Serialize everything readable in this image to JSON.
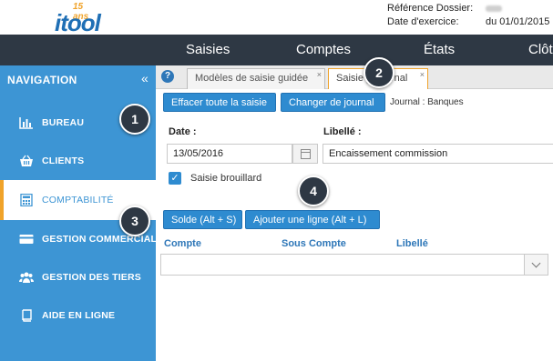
{
  "header": {
    "logo_anniv": "15 ans",
    "logo_text": "itool",
    "ref_label": "Référence Dossier:",
    "exercise_label": "Date d'exercice:",
    "exercise_value": "du 01/01/2015"
  },
  "topnav": {
    "items": [
      "Saisies",
      "Comptes",
      "États",
      "Clôt"
    ]
  },
  "sidebar": {
    "title": "NAVIGATION",
    "collapse_icon": "«",
    "items": [
      {
        "label": "BUREAU",
        "icon": "bar-chart-icon"
      },
      {
        "label": "CLIENTS",
        "icon": "basket-icon"
      },
      {
        "label": "COMPTABILITÉ",
        "icon": "calculator-icon",
        "active": true
      },
      {
        "label": "GESTION COMMERCIALE",
        "icon": "card-icon"
      },
      {
        "label": "GESTION DES TIERS",
        "icon": "users-icon"
      },
      {
        "label": "AIDE EN LIGNE",
        "icon": "book-icon"
      }
    ]
  },
  "tabs": [
    {
      "label": "Modèles de saisie guidée",
      "close": "×"
    },
    {
      "label": "Saisie p",
      "label_tail": "rnal",
      "close": "×",
      "active": true
    }
  ],
  "toolbar": {
    "clear_label": "Effacer toute la saisie",
    "change_journal_label": "Changer de journal",
    "journal_prefix": "Journal : ",
    "journal_value": "Banques"
  },
  "form": {
    "date_label": "Date :",
    "date_value": "13/05/2016",
    "libelle_label": "Libellé :",
    "libelle_value": "Encaissement commission",
    "draft_label": "Saisie brouillard",
    "draft_checked": true
  },
  "actions": {
    "solde_label": "Solde (Alt + S)",
    "add_line_label": "Ajouter une ligne (Alt + L)"
  },
  "grid": {
    "columns": [
      "Compte",
      "Sous Compte",
      "Libellé"
    ]
  },
  "callouts": [
    "1",
    "2",
    "3",
    "4"
  ],
  "colors": {
    "primary": "#3d95d4",
    "topnav": "#2e3844",
    "accent": "#f0a32a",
    "button": "#2e8bd0"
  }
}
